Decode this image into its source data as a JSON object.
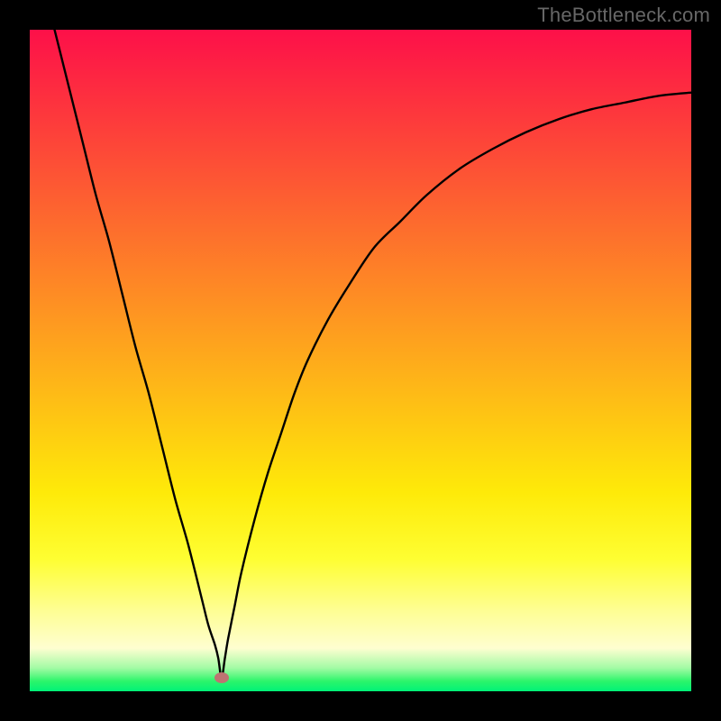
{
  "watermark": "TheBottleneck.com",
  "chart_data": {
    "type": "line",
    "title": "",
    "xlabel": "",
    "ylabel": "",
    "xlim": [
      0,
      100
    ],
    "ylim": [
      0,
      100
    ],
    "grid": false,
    "minimum_x": 29,
    "minimum_y": 2,
    "gradient_stops": [
      {
        "pos": 0.0,
        "color": "#fd1049"
      },
      {
        "pos": 0.1,
        "color": "#fd2f3f"
      },
      {
        "pos": 0.2,
        "color": "#fd4e36"
      },
      {
        "pos": 0.3,
        "color": "#fd6d2d"
      },
      {
        "pos": 0.4,
        "color": "#fe8c24"
      },
      {
        "pos": 0.5,
        "color": "#feab1b"
      },
      {
        "pos": 0.6,
        "color": "#feca12"
      },
      {
        "pos": 0.7,
        "color": "#feea09"
      },
      {
        "pos": 0.8,
        "color": "#fefe32"
      },
      {
        "pos": 0.875,
        "color": "#fefe90"
      },
      {
        "pos": 0.935,
        "color": "#fefed0"
      },
      {
        "pos": 0.965,
        "color": "#a2fba4"
      },
      {
        "pos": 0.985,
        "color": "#2bf56a"
      },
      {
        "pos": 1.0,
        "color": "#00f278"
      }
    ],
    "series": [
      {
        "name": "bottleneck-curve",
        "color": "#000000",
        "x": [
          0,
          2,
          4,
          6,
          8,
          10,
          12,
          14,
          16,
          18,
          20,
          22,
          24,
          26,
          27,
          28,
          28.5,
          29,
          29.5,
          30,
          31,
          32,
          34,
          36,
          38,
          40,
          42,
          45,
          48,
          52,
          56,
          60,
          65,
          70,
          75,
          80,
          85,
          90,
          95,
          100
        ],
        "y": [
          115,
          107,
          99,
          91,
          83,
          75,
          68,
          60,
          52,
          45,
          37,
          29,
          22,
          14,
          10,
          7,
          5,
          2,
          5,
          8,
          13,
          18,
          26,
          33,
          39,
          45,
          50,
          56,
          61,
          67,
          71,
          75,
          79,
          82,
          84.5,
          86.5,
          88,
          89,
          90,
          90.5
        ]
      }
    ],
    "marker": {
      "x": 29,
      "y": 2,
      "color": "#bd7472"
    }
  }
}
